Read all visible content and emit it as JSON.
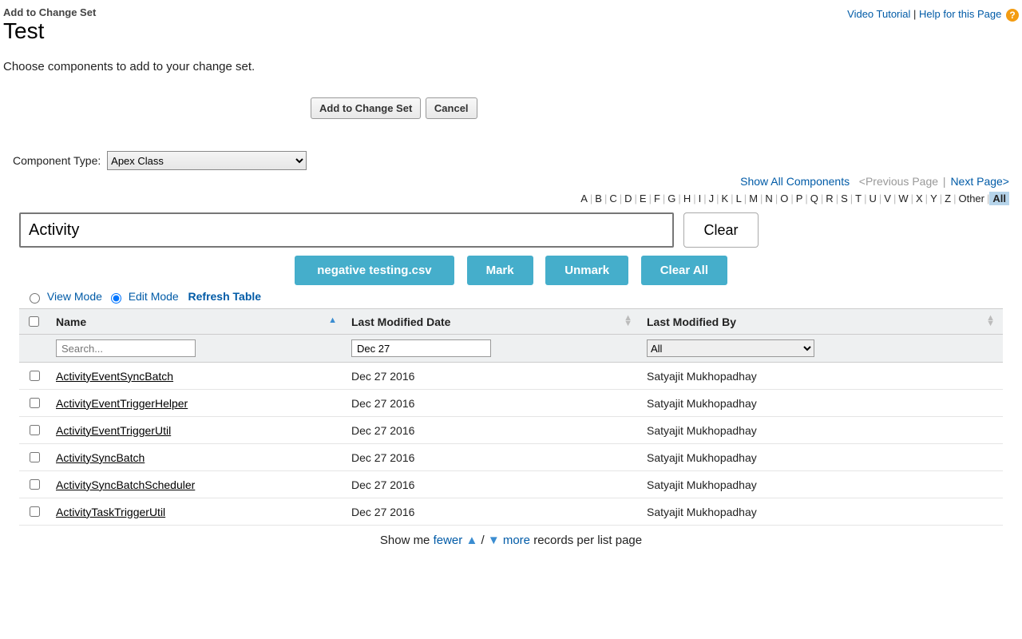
{
  "header": {
    "subtitle": "Add to Change Set",
    "title": "Test",
    "videoLink": "Video Tutorial",
    "helpLink": "Help for this Page",
    "description": "Choose components to add to your change set."
  },
  "topButtons": {
    "add": "Add to Change Set",
    "cancel": "Cancel"
  },
  "componentType": {
    "label": "Component Type:",
    "selected": "Apex Class"
  },
  "pager": {
    "showAll": "Show All Components",
    "prev": "<Previous Page",
    "next": "Next Page>",
    "sep": "|"
  },
  "alpha": {
    "letters": [
      "A",
      "B",
      "C",
      "D",
      "E",
      "F",
      "G",
      "H",
      "I",
      "J",
      "K",
      "L",
      "M",
      "N",
      "O",
      "P",
      "Q",
      "R",
      "S",
      "T",
      "U",
      "V",
      "W",
      "X",
      "Y",
      "Z"
    ],
    "other": "Other",
    "selected": "All"
  },
  "search": {
    "value": "Activity",
    "clear": "Clear"
  },
  "actions": {
    "file": "negative testing.csv",
    "mark": "Mark",
    "unmark": "Unmark",
    "clearAll": "Clear All"
  },
  "mode": {
    "view": "View Mode",
    "edit": "Edit Mode",
    "refresh": "Refresh Table"
  },
  "table": {
    "headers": {
      "name": "Name",
      "date": "Last Modified Date",
      "by": "Last Modified By"
    },
    "filters": {
      "namePlaceholder": "Search...",
      "dateValue": "Dec 27",
      "bySelected": "All"
    },
    "rows": [
      {
        "name": "ActivityEventSyncBatch",
        "date": "Dec 27 2016",
        "by": "Satyajit Mukhopadhay"
      },
      {
        "name": "ActivityEventTriggerHelper",
        "date": "Dec 27 2016",
        "by": "Satyajit Mukhopadhay"
      },
      {
        "name": "ActivityEventTriggerUtil",
        "date": "Dec 27 2016",
        "by": "Satyajit Mukhopadhay"
      },
      {
        "name": "ActivitySyncBatch",
        "date": "Dec 27 2016",
        "by": "Satyajit Mukhopadhay"
      },
      {
        "name": "ActivitySyncBatchScheduler",
        "date": "Dec 27 2016",
        "by": "Satyajit Mukhopadhay"
      },
      {
        "name": "ActivityTaskTriggerUtil",
        "date": "Dec 27 2016",
        "by": "Satyajit Mukhopadhay"
      }
    ]
  },
  "footer": {
    "prefix": "Show me ",
    "fewer": "fewer",
    "mid": " / ",
    "more": "more",
    "suffix": " records per list page"
  }
}
